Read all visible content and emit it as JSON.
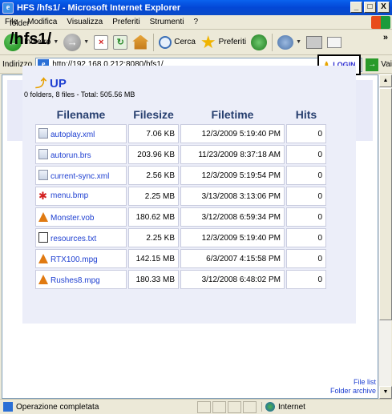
{
  "window": {
    "title": "HFS /hfs1/ - Microsoft Internet Explorer",
    "minimize": "_",
    "maximize": "□",
    "close": "X"
  },
  "menubar": [
    "File",
    "Modifica",
    "Visualizza",
    "Preferiti",
    "Strumenti",
    "?"
  ],
  "toolbar": {
    "back": "Indietro",
    "search": "Cerca",
    "favorites": "Preferiti",
    "more": "»"
  },
  "address": {
    "label": "Indirizzo",
    "url": "http://192.168.0.212:8080/hfs1/",
    "go": "Vai"
  },
  "page": {
    "folder_label": "folder",
    "path": "/hfs1/",
    "login": "LOGIN",
    "up": "UP",
    "summary": "0 folders, 8 files - Total: 505.56 MB",
    "columns": [
      "Filename",
      "Filesize",
      "Filetime",
      "Hits"
    ],
    "files": [
      {
        "name": "autoplay.xml",
        "size": "7.06 KB",
        "time": "12/3/2009 5:19:40 PM",
        "hits": "0",
        "icon": "doc-icon"
      },
      {
        "name": "autorun.brs",
        "size": "203.96 KB",
        "time": "11/23/2009 8:37:18 AM",
        "hits": "0",
        "icon": "doc-icon"
      },
      {
        "name": "current-sync.xml",
        "size": "2.56 KB",
        "time": "12/3/2009 5:19:54 PM",
        "hits": "0",
        "icon": "doc-icon"
      },
      {
        "name": "menu.bmp",
        "size": "2.25 MB",
        "time": "3/13/2008 3:13:06 PM",
        "hits": "0",
        "icon": "image-icon"
      },
      {
        "name": "Monster.vob",
        "size": "180.62 MB",
        "time": "3/12/2008 6:59:34 PM",
        "hits": "0",
        "icon": "video-icon"
      },
      {
        "name": "resources.txt",
        "size": "2.25 KB",
        "time": "12/3/2009 5:19:40 PM",
        "hits": "0",
        "icon": "text-icon"
      },
      {
        "name": "RTX100.mpg",
        "size": "142.15 MB",
        "time": "6/3/2007 4:15:58 PM",
        "hits": "0",
        "icon": "video-icon"
      },
      {
        "name": "Rushes8.mpg",
        "size": "180.33 MB",
        "time": "3/12/2008 6:48:02 PM",
        "hits": "0",
        "icon": "video-icon"
      }
    ],
    "file_list_link": "File list",
    "folder_archive_link": "Folder archive"
  },
  "status": {
    "text": "Operazione completata",
    "zone": "Internet"
  }
}
